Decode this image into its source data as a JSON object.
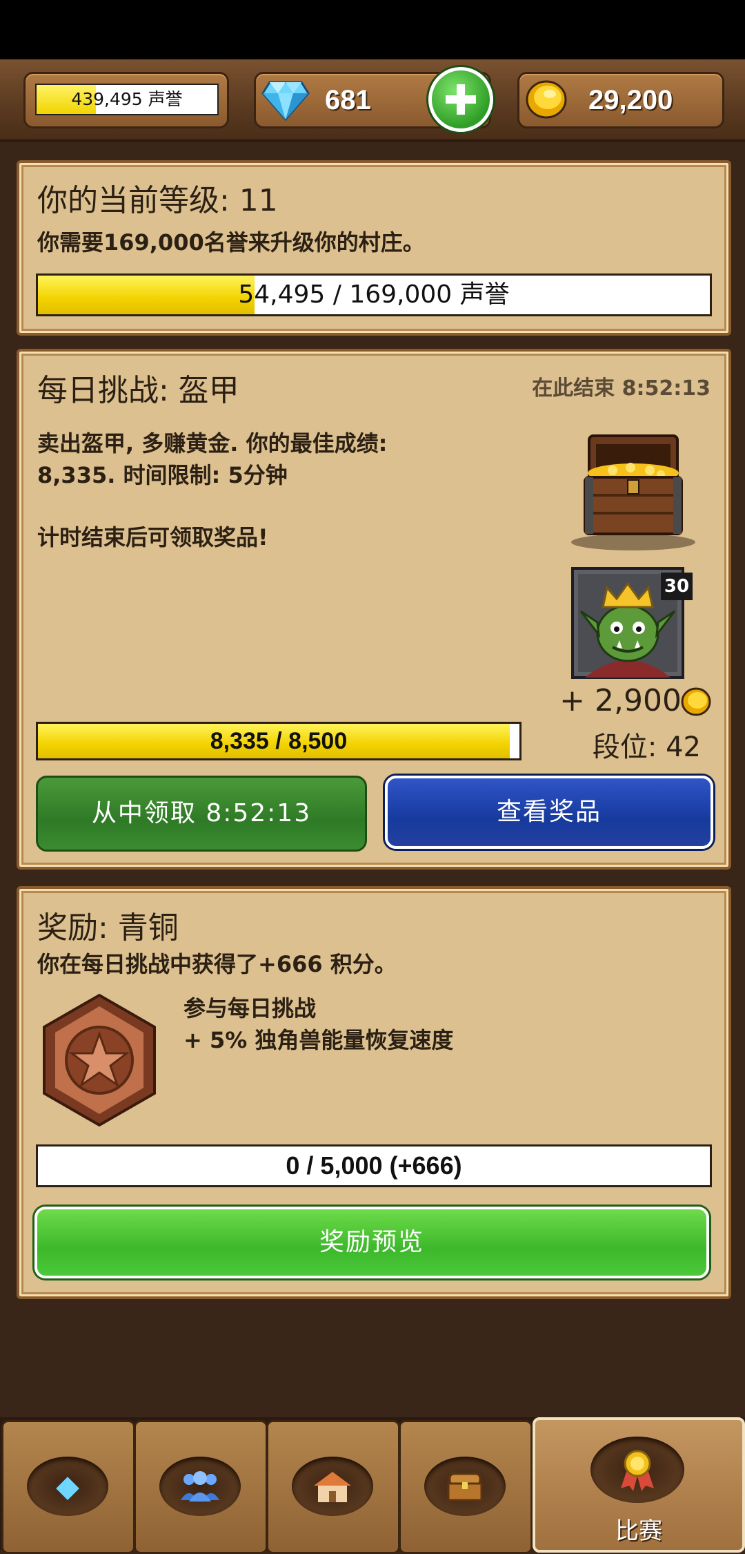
{
  "topbar": {
    "fame_text": "439,495 声誉",
    "fame_progress": 0.33,
    "gems": "681",
    "gold": "29,200"
  },
  "level_panel": {
    "title": "你的当前等级: 11",
    "description": "你需要169,000名誉来升级你的村庄。",
    "progress_text": "54,495 / 169,000 声誉",
    "progress": 0.3225
  },
  "challenge_panel": {
    "title": "每日挑战: 盔甲",
    "ends_text": "在此结束 8:52:13",
    "description_line1": "卖出盔甲, 多赚黄金. 你的最佳成绩:",
    "description_line2": "8,335. 时间限制: 5分钟",
    "note": "计时结束后可领取奖品!",
    "avatar_level": "30",
    "reward_text": "+ 2,900",
    "rank_text": "段位: 42",
    "progress_text": "8,335 / 8,500",
    "progress": 0.98,
    "claim_button": "从中领取 8:52:13",
    "view_prizes_button": "查看奖品"
  },
  "reward_panel": {
    "title": "奖励: 青铜",
    "description": "你在每日挑战中获得了+666 积分。",
    "perk_line1": "参与每日挑战",
    "perk_line2": "+ 5% 独角兽能量恢复速度",
    "progress_text": "0 / 5,000 (+666)",
    "progress": 0,
    "preview_button": "奖励预览"
  },
  "nav": {
    "active_label": "比赛"
  },
  "colors": {
    "panel_bg": "#dcc090",
    "wood": "#8a5c2c",
    "yellow_fill": "#f2d300",
    "green_button": "#3cb82a",
    "blue_button": "#173a9e"
  }
}
